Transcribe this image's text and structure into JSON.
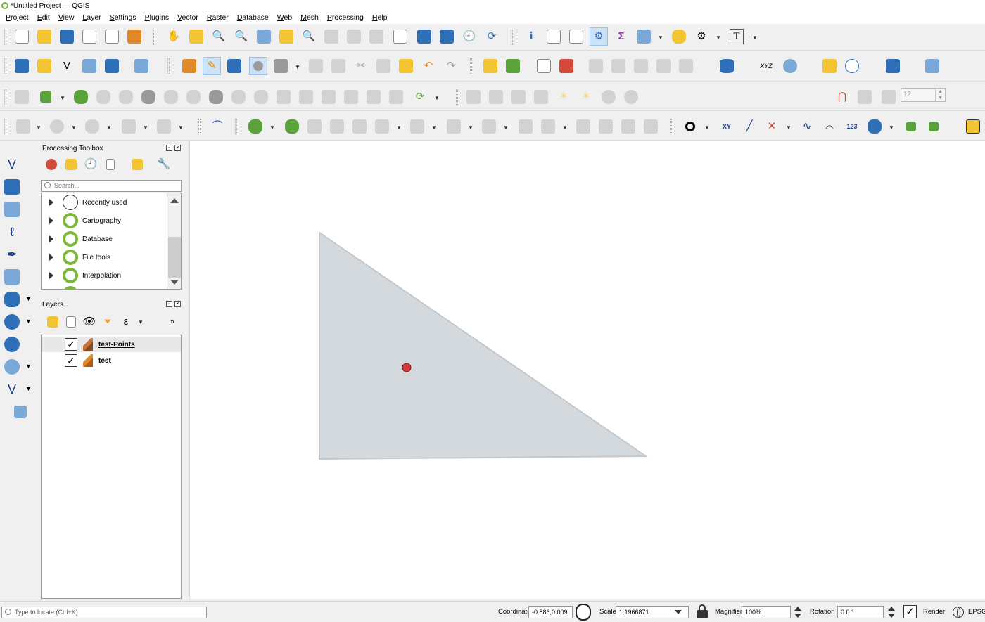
{
  "window": {
    "title": "*Untitled Project — QGIS"
  },
  "menubar": {
    "items": [
      "Project",
      "Edit",
      "View",
      "Layer",
      "Settings",
      "Plugins",
      "Vector",
      "Raster",
      "Database",
      "Web",
      "Mesh",
      "Processing",
      "Help"
    ]
  },
  "toolbars": {
    "attribute_toolbar_spin_value": "12"
  },
  "processing_toolbox": {
    "title": "Processing Toolbox",
    "search_placeholder": "Search...",
    "items": [
      {
        "label": "Recently used",
        "icon": "clock-icon"
      },
      {
        "label": "Cartography",
        "icon": "qgis-icon"
      },
      {
        "label": "Database",
        "icon": "qgis-icon"
      },
      {
        "label": "File tools",
        "icon": "qgis-icon"
      },
      {
        "label": "Interpolation",
        "icon": "qgis-icon"
      }
    ]
  },
  "layers_panel": {
    "title": "Layers",
    "more": "»",
    "layers": [
      {
        "name": "test-Points",
        "checked": true,
        "selected": true
      },
      {
        "name": "test",
        "checked": true,
        "selected": false
      }
    ]
  },
  "map_canvas": {
    "features": [
      {
        "layer": "test",
        "geometry": "polygon",
        "fill": "#d4d9dd",
        "stroke": "#c2c8cc"
      },
      {
        "layer": "test-Points",
        "geometry": "point",
        "fill": "#d6393a",
        "stroke": "#7a2020"
      }
    ]
  },
  "statusbar": {
    "locator_placeholder": "Type to locate (Ctrl+K)",
    "coordinate_label": "Coordinate",
    "coordinate_value": "-0.886,0.009",
    "scale_label": "Scale",
    "scale_value": "1:1966871",
    "magnifier_label": "Magnifier",
    "magnifier_value": "100%",
    "rotation_label": "Rotation",
    "rotation_value": "0.0 °",
    "render_label": "Render",
    "crs_label": "EPSG:"
  }
}
